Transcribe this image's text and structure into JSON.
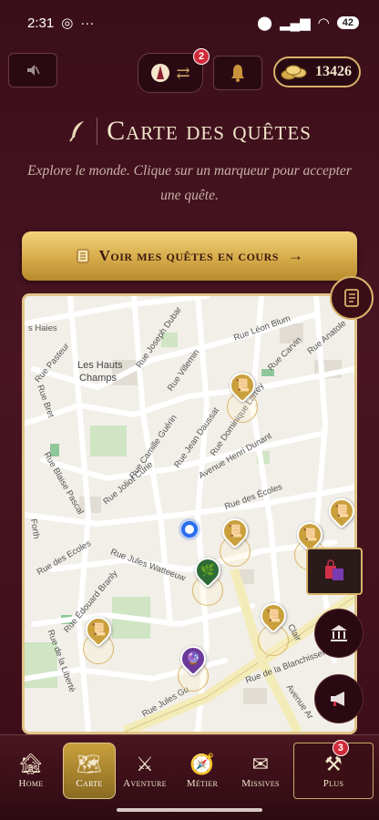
{
  "status": {
    "time": "2:31",
    "battery": "42"
  },
  "header": {
    "swap_badge": "2",
    "coins": "13426"
  },
  "page": {
    "title": "Carte des quêtes",
    "subtitle": "Explore le monde. Clique sur un marqueur pour accepter une quête.",
    "cta_label": "Voir mes quêtes en cours"
  },
  "map": {
    "labels": [
      "s Haies",
      "Rue Pasteur",
      "Les Hauts",
      "Champs",
      "Rue Joseph Dubar",
      "Rue Léon Blum",
      "Rue Carvin",
      "Rue Anatole",
      "Rue Villemin",
      "Rue Camille Guérin",
      "Rue Jean Daussat",
      "Rue Dominique Larrey",
      "Avenue Henri Dunant",
      "Rue des Écoles",
      "Rue Blaise Pascal",
      "Rue Jules Watteeuw",
      "Rue Édouard Branly",
      "Rue de la Blanchisserie",
      "Rue de la Liberté",
      "Avenue Ar",
      "Rue Jules Gu",
      "Rue Bret",
      "Forth",
      "Rue Joliot Curie",
      "Rue des Ecoles",
      "Clair"
    ]
  },
  "nav": {
    "items": [
      {
        "label": "Home"
      },
      {
        "label": "Carte"
      },
      {
        "label": "Aventure"
      },
      {
        "label": "Métier"
      },
      {
        "label": "Missives"
      },
      {
        "label": "Plus"
      }
    ],
    "plus_badge": "3"
  },
  "colors": {
    "background": "#3a0f1a",
    "accent_gold": "#d8b36a",
    "badge_red": "#d02a3a"
  },
  "icons": {
    "mute": "speaker-muted-icon",
    "swap": "swap-icon",
    "bell": "bell-icon",
    "coins": "coins-icon",
    "quill": "quill-icon",
    "scroll": "scroll-icon",
    "book": "book-icon",
    "shop": "shopping-bags-icon",
    "bank": "bank-icon",
    "horn": "megaphone-icon"
  }
}
